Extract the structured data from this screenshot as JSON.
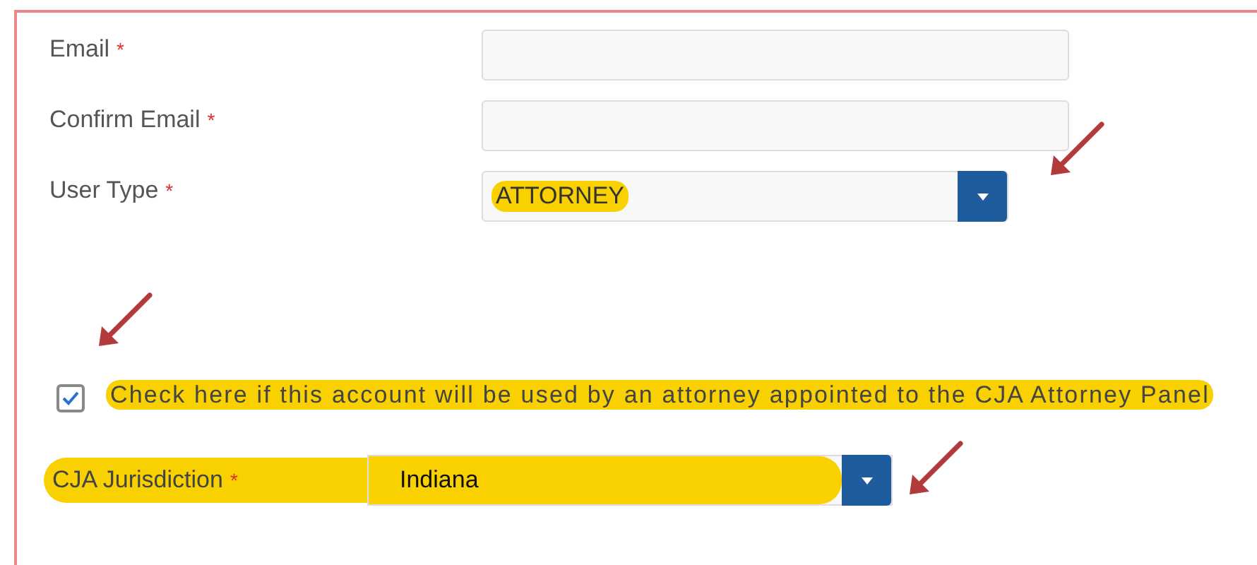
{
  "fields": [
    {
      "kind": "text",
      "label": "Email",
      "required_mark": "*"
    },
    {
      "kind": "text",
      "label": "Confirm Email",
      "required_mark": "*"
    },
    {
      "kind": "select",
      "label": "User Type",
      "required_mark": "*",
      "value": "ATTORNEY",
      "highlighted": true
    }
  ],
  "cja_checkbox": {
    "label": "Check here if this account will be used by an attorney appointed to the CJA Attorney Panel",
    "checked": true,
    "highlighted": true
  },
  "jurisdiction": {
    "label": "CJA Jurisdiction",
    "required_mark": "*",
    "value": "Indiana",
    "highlighted": true
  }
}
